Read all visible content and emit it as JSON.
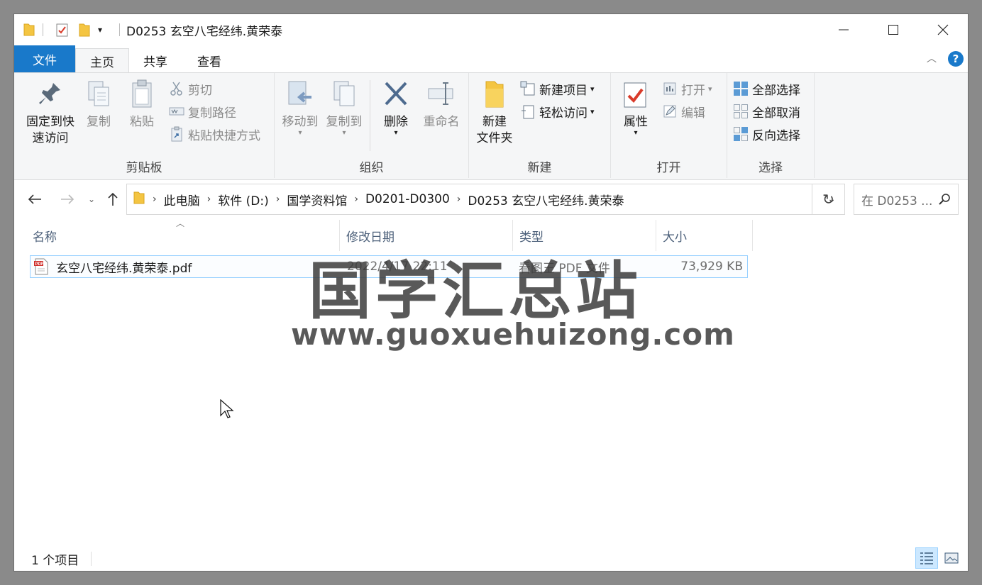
{
  "window": {
    "title": "D0253 玄空八宅经纬.黄荣泰"
  },
  "tabs": {
    "file": "文件",
    "home": "主页",
    "share": "共享",
    "view": "查看"
  },
  "ribbon": {
    "clipboard": {
      "label": "剪贴板",
      "pin_line1": "固定到快",
      "pin_line2": "速访问",
      "copy": "复制",
      "paste": "粘贴",
      "cut": "剪切",
      "copy_path": "复制路径",
      "paste_shortcut": "粘贴快捷方式"
    },
    "organize": {
      "label": "组织",
      "move_to": "移动到",
      "copy_to": "复制到",
      "delete": "删除",
      "rename": "重命名"
    },
    "new": {
      "label": "新建",
      "new_folder_line1": "新建",
      "new_folder_line2": "文件夹",
      "new_item": "新建项目",
      "easy_access": "轻松访问"
    },
    "open": {
      "label": "打开",
      "properties": "属性",
      "open": "打开",
      "edit": "编辑"
    },
    "select": {
      "label": "选择",
      "select_all": "全部选择",
      "select_none": "全部取消",
      "invert": "反向选择"
    }
  },
  "address": {
    "crumbs": [
      "此电脑",
      "软件 (D:)",
      "国学资料馆",
      "D0201-D0300",
      "D0253 玄空八宅经纬.黄荣泰"
    ],
    "search_placeholder": "在 D0253 ..."
  },
  "columns": {
    "name": "名称",
    "modified": "修改日期",
    "type": "类型",
    "size": "大小"
  },
  "files": [
    {
      "name": "玄空八宅经纬.黄荣泰.pdf",
      "modified": "2022/4/17 22:11",
      "type": "看图王 PDF 文件",
      "size": "73,929 KB"
    }
  ],
  "status": {
    "count": "1 个项目"
  },
  "watermark": {
    "title": "国学汇总站",
    "url": "www.guoxuehuizong.com"
  },
  "colors": {
    "accent": "#1979ca",
    "folder": "#f4c542",
    "selection_border": "#99d1ff"
  }
}
